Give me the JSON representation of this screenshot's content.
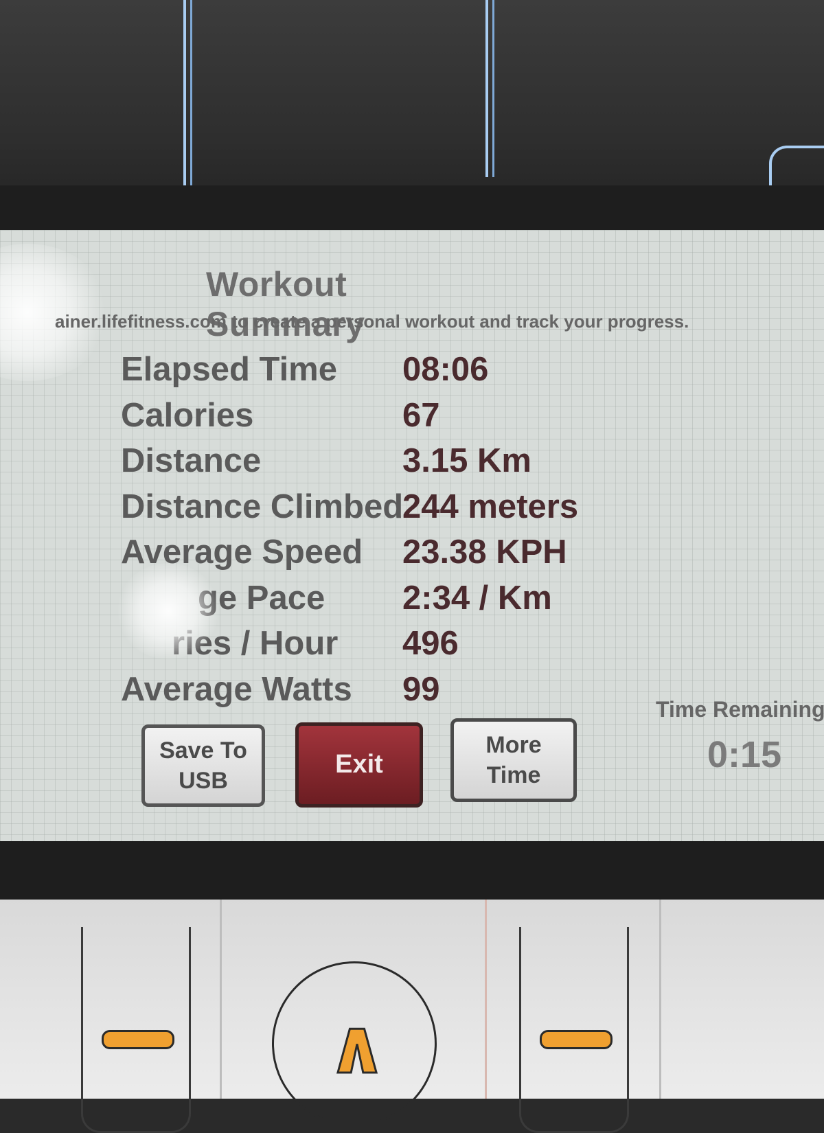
{
  "screen": {
    "title": "Workout Summary",
    "subtitle": "ainer.lifefitness.com to create a personal workout and track your progress."
  },
  "metrics": [
    {
      "label": "Elapsed Time",
      "value": "08:06"
    },
    {
      "label": "Calories",
      "value": "67"
    },
    {
      "label": "Distance",
      "value": "3.15 Km"
    },
    {
      "label": "Distance Climbed",
      "value": "244 meters"
    },
    {
      "label": "Average Speed",
      "value": "23.38 KPH"
    },
    {
      "label": "ge Pace",
      "value": "2:34 / Km"
    },
    {
      "label": "ries / Hour",
      "value": "496"
    },
    {
      "label": "Average Watts",
      "value": "99"
    }
  ],
  "buttons": {
    "save_usb": "Save To USB",
    "exit": "Exit",
    "more_time": "More Time"
  },
  "time_remaining": {
    "label": "Time Remaining",
    "value": "0:15"
  },
  "colors": {
    "exit_button": "#8a252c",
    "accent_keys": "#f0a030"
  },
  "keypad": {
    "icons": [
      "minus-icon",
      "up-arrow-icon",
      "minus-icon"
    ]
  }
}
